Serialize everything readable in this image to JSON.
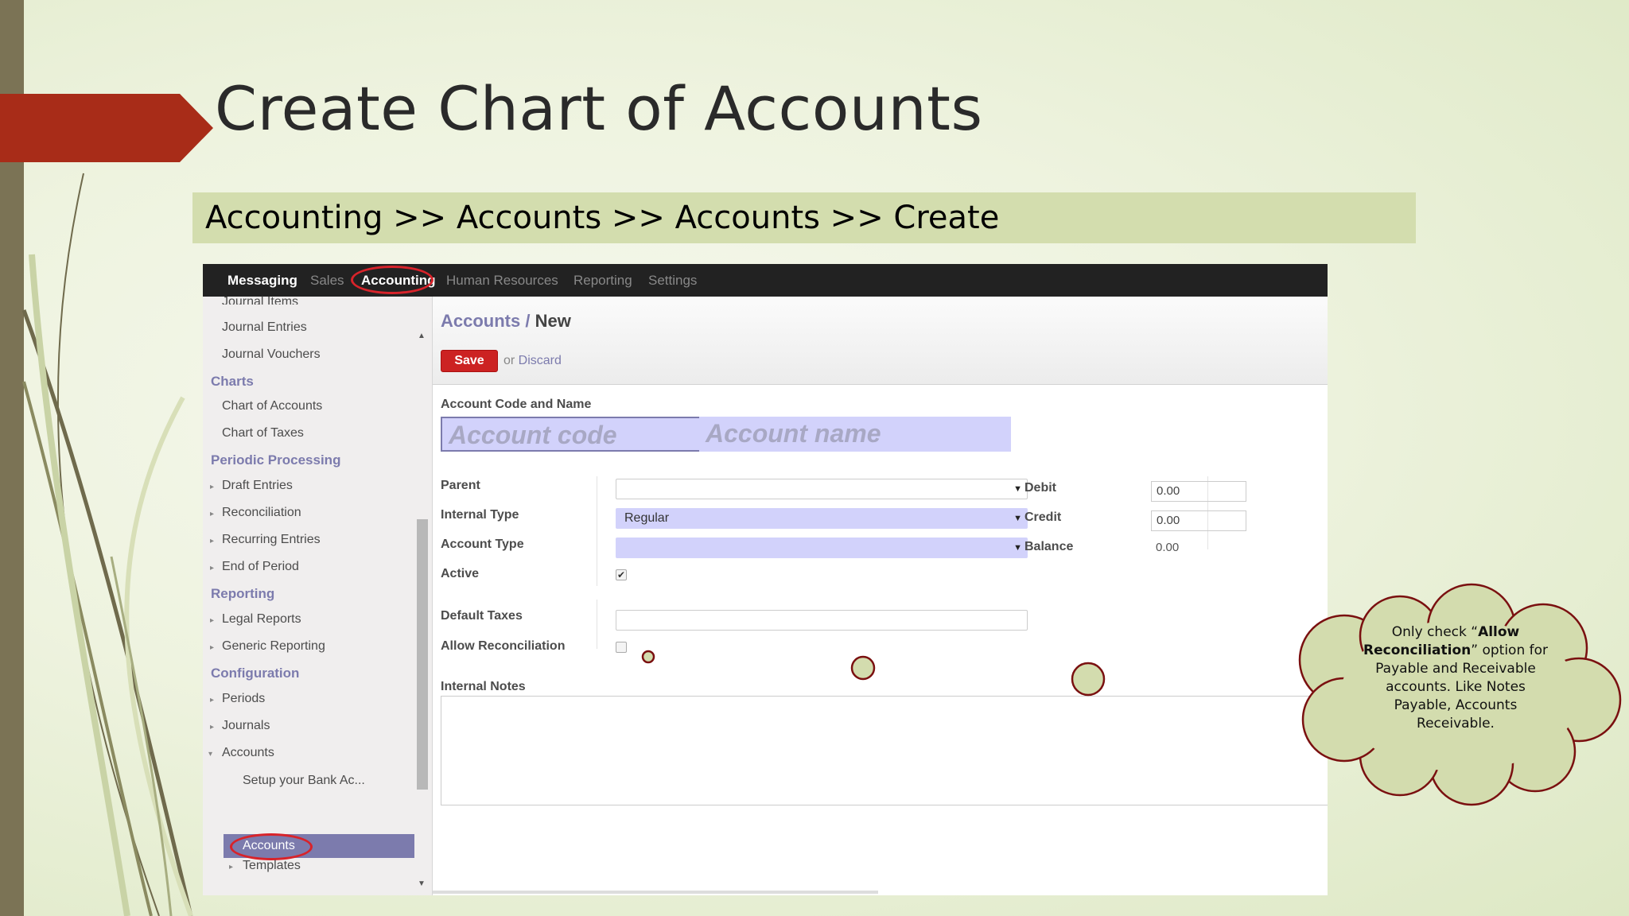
{
  "slide": {
    "title": "Create Chart of Accounts",
    "breadcrumb": "Accounting >> Accounts >> Accounts  >> Create"
  },
  "colors": {
    "accent_red": "#a82c18",
    "odoo_purple": "#7c7bad",
    "save_red": "#cc2222",
    "band_green": "#d3ddae"
  },
  "topnav": {
    "items": [
      "Messaging",
      "Sales",
      "Accounting",
      "Human Resources",
      "Reporting",
      "Settings"
    ],
    "active": "Accounting"
  },
  "sidebar": {
    "partial_top": "Journal Items",
    "journal_entries": "Journal Entries",
    "journal_vouchers": "Journal Vouchers",
    "charts_head": "Charts",
    "chart_of_accounts": "Chart of Accounts",
    "chart_of_taxes": "Chart of Taxes",
    "periodic_head": "Periodic Processing",
    "draft_entries": "Draft Entries",
    "reconciliation": "Reconciliation",
    "recurring_entries": "Recurring Entries",
    "end_of_period": "End of Period",
    "reporting_head": "Reporting",
    "legal_reports": "Legal Reports",
    "generic_reporting": "Generic Reporting",
    "configuration_head": "Configuration",
    "periods": "Periods",
    "journals": "Journals",
    "accounts": "Accounts",
    "setup_bank": "Setup your Bank Ac...",
    "accounts_selected": "Accounts",
    "templates": "Templates"
  },
  "header": {
    "crumb_parent": "Accounts",
    "crumb_sep": " / ",
    "crumb_current": "New",
    "save_label": "Save",
    "or_text": "or ",
    "discard_label": "Discard"
  },
  "form": {
    "code_name_label": "Account Code and Name",
    "code_placeholder": "Account code",
    "name_placeholder": "Account name",
    "dash": "-",
    "parent_label": "Parent",
    "parent_value": "",
    "internal_type_label": "Internal Type",
    "internal_type_value": "Regular",
    "account_type_label": "Account Type",
    "account_type_value": "",
    "active_label": "Active",
    "active_checked": true,
    "active_mark": "✔",
    "debit_label": "Debit",
    "debit_value": "0.00",
    "credit_label": "Credit",
    "credit_value": "0.00",
    "balance_label": "Balance",
    "balance_value": "0.00",
    "default_taxes_label": "Default Taxes",
    "allow_reconciliation_label": "Allow Reconciliation",
    "allow_reconciliation_checked": false,
    "internal_notes_label": "Internal Notes"
  },
  "callout": {
    "pre": "Only check “",
    "bold1": "Allow Reconciliation",
    "post": "” option for Payable and Receivable accounts. Like Notes Payable, Accounts Receivable."
  }
}
